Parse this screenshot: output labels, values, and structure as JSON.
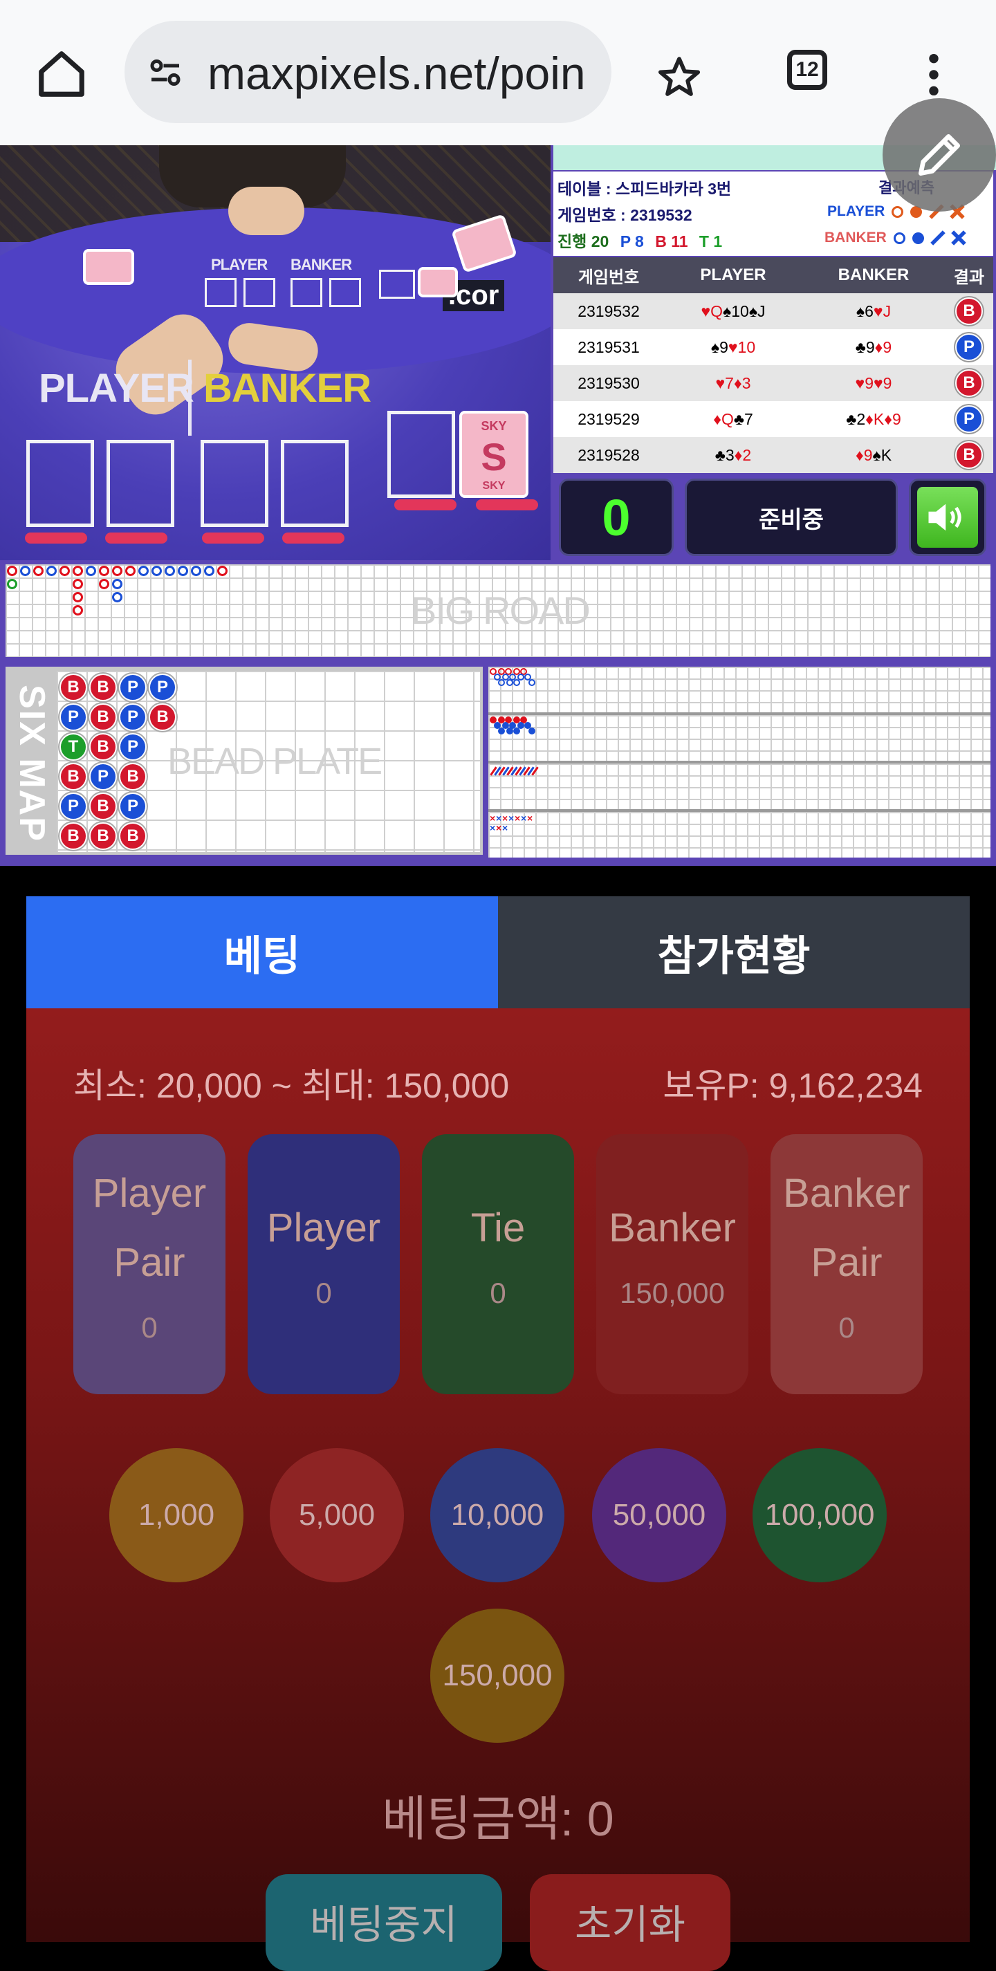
{
  "browser": {
    "url": "maxpixels.net/poin",
    "tab_count": "12"
  },
  "video": {
    "player_label": "PLAYER",
    "banker_label": "BANKER",
    "small_player": "PLAYER",
    "small_banker": "BANKER",
    "card_brand": "SKY",
    "domain_fragment": ".cor"
  },
  "info": {
    "table_line": "테이블 : 스피드바카라 3번",
    "prediction_title": "결과예측",
    "game_number_line": "게임번호 : 2319532",
    "progress_label": "진행 20",
    "p_count": "P 8",
    "b_count": "B 11",
    "t_count": "T 1",
    "pred_player": "PLAYER",
    "pred_banker": "BANKER"
  },
  "history": {
    "headers": [
      "게임번호",
      "PLAYER",
      "BANKER",
      "결과"
    ],
    "rows": [
      {
        "id": "2319532",
        "player": [
          [
            "♥",
            "Q",
            "r"
          ],
          [
            "♠",
            "10",
            "k"
          ],
          [
            "♠",
            "J",
            "k"
          ]
        ],
        "banker": [
          [
            "♠",
            "6",
            "k"
          ],
          [
            "♥",
            "J",
            "r"
          ]
        ],
        "result": "B"
      },
      {
        "id": "2319531",
        "player": [
          [
            "♠",
            "9",
            "k"
          ],
          [
            "♥",
            "10",
            "r"
          ]
        ],
        "banker": [
          [
            "♣",
            "9",
            "k"
          ],
          [
            "♦",
            "9",
            "r"
          ]
        ],
        "result": "P"
      },
      {
        "id": "2319530",
        "player": [
          [
            "♥",
            "7",
            "r"
          ],
          [
            "♦",
            "3",
            "r"
          ]
        ],
        "banker": [
          [
            "♥",
            "9",
            "r"
          ],
          [
            "♥",
            "9",
            "r"
          ]
        ],
        "result": "B"
      },
      {
        "id": "2319529",
        "player": [
          [
            "♦",
            "Q",
            "r"
          ],
          [
            "♣",
            "7",
            "k"
          ]
        ],
        "banker": [
          [
            "♣",
            "2",
            "k"
          ],
          [
            "♦",
            "K",
            "r"
          ],
          [
            "♦",
            "9",
            "r"
          ]
        ],
        "result": "P"
      },
      {
        "id": "2319528",
        "player": [
          [
            "♣",
            "3",
            "k"
          ],
          [
            "♦",
            "2",
            "r"
          ]
        ],
        "banker": [
          [
            "♦",
            "9",
            "r"
          ],
          [
            "♠",
            "K",
            "k"
          ]
        ],
        "result": "B"
      }
    ]
  },
  "controls": {
    "timer": "0",
    "status": "준비중"
  },
  "roads": {
    "big_road_label": "BIG ROAD",
    "bead_plate_label": "BEAD PLATE",
    "six_map_label": "SIX MAP",
    "bead_columns": [
      [
        "B",
        "P",
        "T",
        "B",
        "P",
        "B"
      ],
      [
        "B",
        "B",
        "B",
        "P",
        "B",
        "B"
      ],
      [
        "P",
        "P",
        "P",
        "B",
        "P",
        "B"
      ],
      [
        "P",
        "B"
      ]
    ]
  },
  "betting": {
    "tab_bet": "베팅",
    "tab_participants": "참가현황",
    "limits": "최소: 20,000 ~ 최대: 150,000",
    "balance": "보유P: 9,162,234",
    "boxes": [
      {
        "name1": "Player",
        "name2": "Pair",
        "amount": "0"
      },
      {
        "name1": "Player",
        "name2": "",
        "amount": "0"
      },
      {
        "name1": "Tie",
        "name2": "",
        "amount": "0"
      },
      {
        "name1": "Banker",
        "name2": "",
        "amount": "150,000"
      },
      {
        "name1": "Banker",
        "name2": "Pair",
        "amount": "0"
      }
    ],
    "chips": [
      "1,000",
      "5,000",
      "10,000",
      "50,000",
      "100,000",
      "150,000"
    ],
    "bet_amount": "베팅금액: 0",
    "stop_button": "베팅중지",
    "reset_button": "초기화"
  },
  "colors": {
    "tab_active": "#2c6df2",
    "tab_inactive": "#343a44",
    "banker_red": "#d3172d",
    "player_blue": "#1a4fd6",
    "tie_green": "#1c9e2a"
  }
}
